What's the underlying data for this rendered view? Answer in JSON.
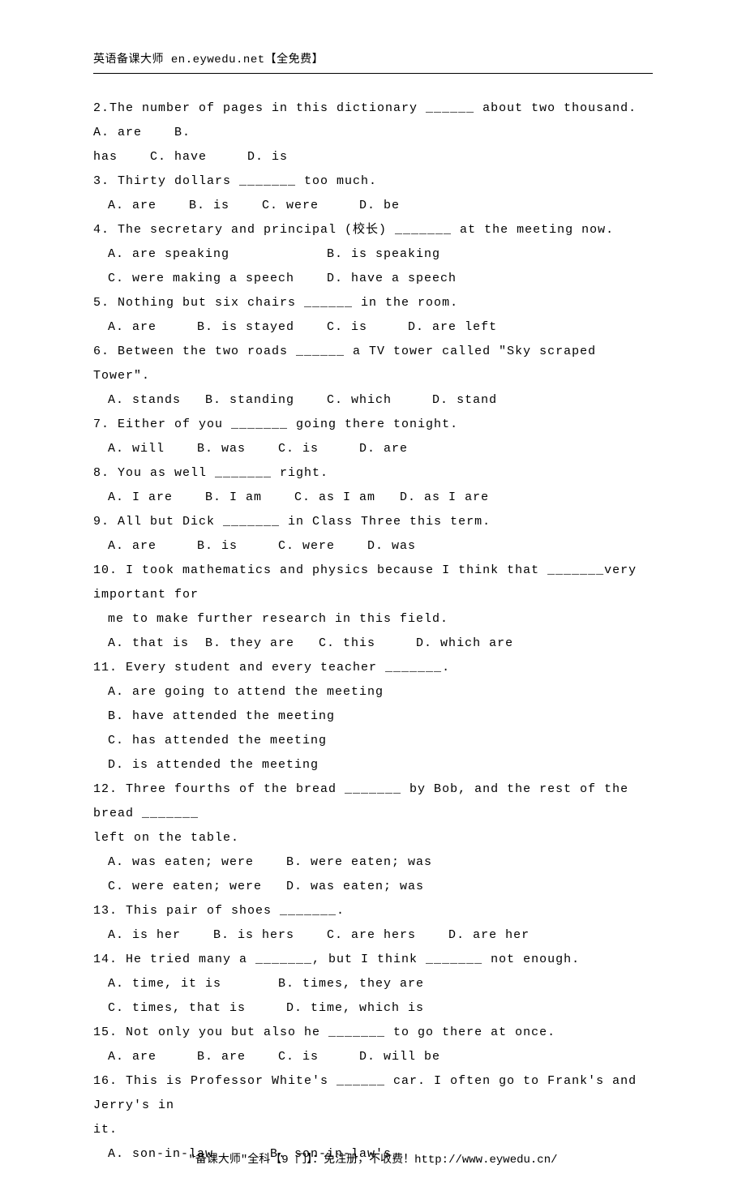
{
  "header": "英语备课大师 en.eywedu.net【全免费】",
  "footer": "\"备课大师\"全科【9 门】：免注册，不收费！http://www.eywedu.cn/",
  "lines": [
    {
      "text": "2.The number of pages in this dictionary ______ about two thousand.  A. are    B.",
      "indent": false
    },
    {
      "text": "has    C. have     D. is",
      "indent": false
    },
    {
      "text": "3. Thirty dollars _______ too much.",
      "indent": false
    },
    {
      "text": "A. are    B. is    C. were     D. be",
      "indent": true
    },
    {
      "text": "4. The secretary and principal (校长) _______ at the meeting now.",
      "indent": false
    },
    {
      "text": "A. are speaking            B. is speaking",
      "indent": true
    },
    {
      "text": "C. were making a speech    D. have a speech",
      "indent": true
    },
    {
      "text": "5. Nothing but six chairs ______ in the room.",
      "indent": false
    },
    {
      "text": "A. are     B. is stayed    C. is     D. are left",
      "indent": true
    },
    {
      "text": "6. Between the two roads ______ a TV tower called \"Sky scraped Tower\".",
      "indent": false
    },
    {
      "text": "A. stands   B. standing    C. which     D. stand",
      "indent": true
    },
    {
      "text": "7. Either of you _______ going there tonight.",
      "indent": false
    },
    {
      "text": "A. will    B. was    C. is     D. are",
      "indent": true
    },
    {
      "text": "8. You as well _______ right.",
      "indent": false
    },
    {
      "text": "A. I are    B. I am    C. as I am   D. as I are",
      "indent": true
    },
    {
      "text": "9. All but Dick _______ in Class Three this term.",
      "indent": false
    },
    {
      "text": "A. are     B. is     C. were    D. was",
      "indent": true
    },
    {
      "text": "10. I took mathematics and physics because I think that _______very important for",
      "indent": false
    },
    {
      "text": "me to make further research in this field.",
      "indent": true
    },
    {
      "text": "A. that is  B. they are   C. this     D. which are",
      "indent": true
    },
    {
      "text": "11. Every student and every teacher _______.",
      "indent": false
    },
    {
      "text": "A. are going to attend the meeting",
      "indent": true
    },
    {
      "text": "B. have attended the meeting",
      "indent": true
    },
    {
      "text": "C. has attended the meeting",
      "indent": true
    },
    {
      "text": "D. is attended the meeting",
      "indent": true
    },
    {
      "text": "12. Three fourths of the bread _______ by Bob, and the rest of the bread _______",
      "indent": false
    },
    {
      "text": "left on the table.",
      "indent": false
    },
    {
      "text": "A. was eaten; were    B. were eaten; was",
      "indent": true
    },
    {
      "text": "C. were eaten; were   D. was eaten; was",
      "indent": true
    },
    {
      "text": "13. This pair of shoes _______.",
      "indent": false
    },
    {
      "text": "A. is her    B. is hers    C. are hers    D. are her",
      "indent": true
    },
    {
      "text": "14. He tried many a _______, but I think _______ not enough.",
      "indent": false
    },
    {
      "text": "A. time, it is       B. times, they are",
      "indent": true
    },
    {
      "text": "C. times, that is     D. time, which is",
      "indent": true
    },
    {
      "text": "15. Not only you but also he _______ to go there at once.",
      "indent": false
    },
    {
      "text": "A. are     B. are    C. is     D. will be",
      "indent": true
    },
    {
      "text": "16. This is Professor White's ______ car. I often go to Frank's and Jerry's in",
      "indent": false
    },
    {
      "text": "it.",
      "indent": false
    },
    {
      "text": "A. son-in-law       B. son-in-law's",
      "indent": true
    }
  ]
}
